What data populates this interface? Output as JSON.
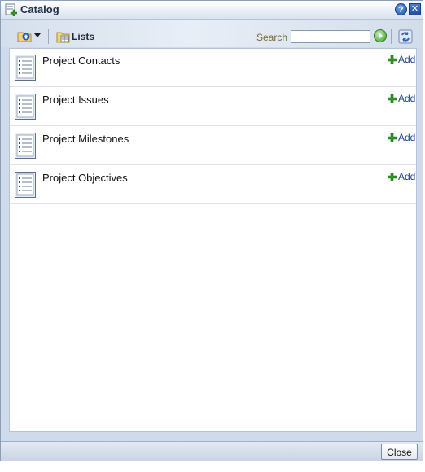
{
  "window": {
    "title": "Catalog",
    "help_label": "?",
    "close_label": "✕"
  },
  "toolbar": {
    "lists_label": "Lists",
    "search_label": "Search",
    "search_value": ""
  },
  "catalog": {
    "items": [
      {
        "title": "Project Contacts",
        "add_label": "Add"
      },
      {
        "title": "Project Issues",
        "add_label": "Add"
      },
      {
        "title": "Project Milestones",
        "add_label": "Add"
      },
      {
        "title": "Project Objectives",
        "add_label": "Add"
      }
    ]
  },
  "footer": {
    "close_label": "Close"
  },
  "icons": {
    "title": "catalog-add-icon",
    "folder_up": "folder-up-icon",
    "lists": "folder-list-icon",
    "search_go": "go-arrow-icon",
    "refresh": "refresh-icon",
    "list_item": "list-document-icon",
    "add": "green-plus-icon"
  },
  "colors": {
    "accent_blue": "#1f3f8f",
    "add_green": "#2e9a22",
    "frame": "#cfdaea"
  }
}
